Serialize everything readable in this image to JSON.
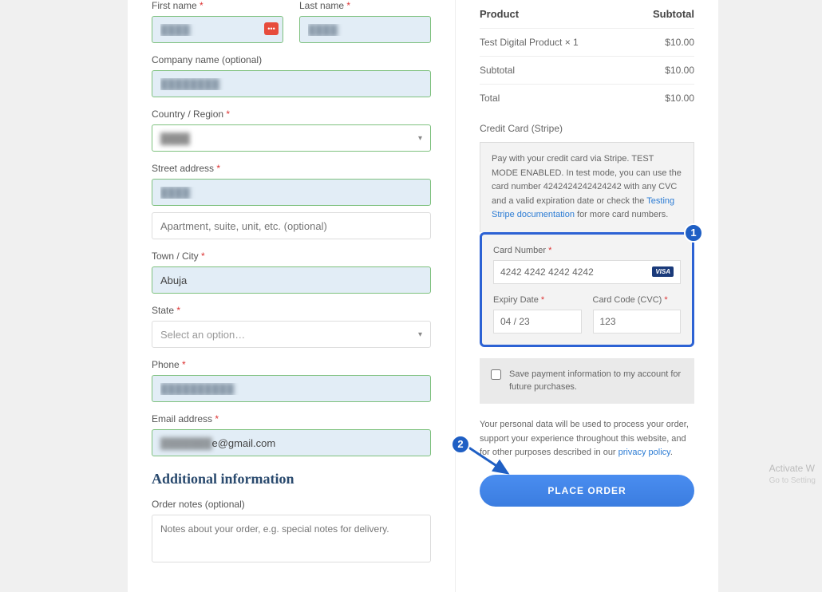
{
  "billing": {
    "first_name": {
      "label": "First name",
      "value": "████"
    },
    "last_name": {
      "label": "Last name",
      "value": "████"
    },
    "company": {
      "label": "Company name (optional)",
      "value": "████████"
    },
    "country": {
      "label": "Country / Region",
      "value": "████"
    },
    "street1": {
      "label": "Street address",
      "value": "████"
    },
    "street2_placeholder": "Apartment, suite, unit, etc. (optional)",
    "city": {
      "label": "Town / City",
      "value": "Abuja"
    },
    "state": {
      "label": "State",
      "placeholder": "Select an option…"
    },
    "phone": {
      "label": "Phone",
      "value": "██████████"
    },
    "email": {
      "label": "Email address",
      "value": "███████e@gmail.com"
    }
  },
  "additional": {
    "heading": "Additional information",
    "notes_label": "Order notes (optional)",
    "notes_placeholder": "Notes about your order, e.g. special notes for delivery."
  },
  "order": {
    "headers": {
      "product": "Product",
      "subtotal": "Subtotal"
    },
    "line_items": [
      {
        "name": "Test Digital Product  × 1",
        "amount": "$10.00"
      }
    ],
    "subtotal": {
      "label": "Subtotal",
      "amount": "$10.00"
    },
    "total": {
      "label": "Total",
      "amount": "$10.00"
    }
  },
  "payment": {
    "method_label": "Credit Card (Stripe)",
    "desc_pre": "Pay with your credit card via Stripe. TEST MODE ENABLED. In test mode, you can use the card number 4242424242424242 with any CVC and a valid expiration date or check the ",
    "desc_link": "Testing Stripe documentation",
    "desc_post": " for more card numbers.",
    "card_number": {
      "label": "Card Number",
      "value": "4242 4242 4242 4242",
      "brand": "VISA"
    },
    "expiry": {
      "label": "Expiry Date",
      "value": "04 / 23"
    },
    "cvc": {
      "label": "Card Code (CVC)",
      "value": "123"
    },
    "save_info": "Save payment information to my account for future purchases."
  },
  "privacy": {
    "text": "Your personal data will be used to process your order, support your experience throughout this website, and for other purposes described in our ",
    "link": "privacy policy"
  },
  "buttons": {
    "place_order": "PLACE ORDER"
  },
  "annotations": {
    "one": "1",
    "two": "2"
  },
  "watermark": {
    "main": "Activate W",
    "sub": "Go to Setting"
  }
}
